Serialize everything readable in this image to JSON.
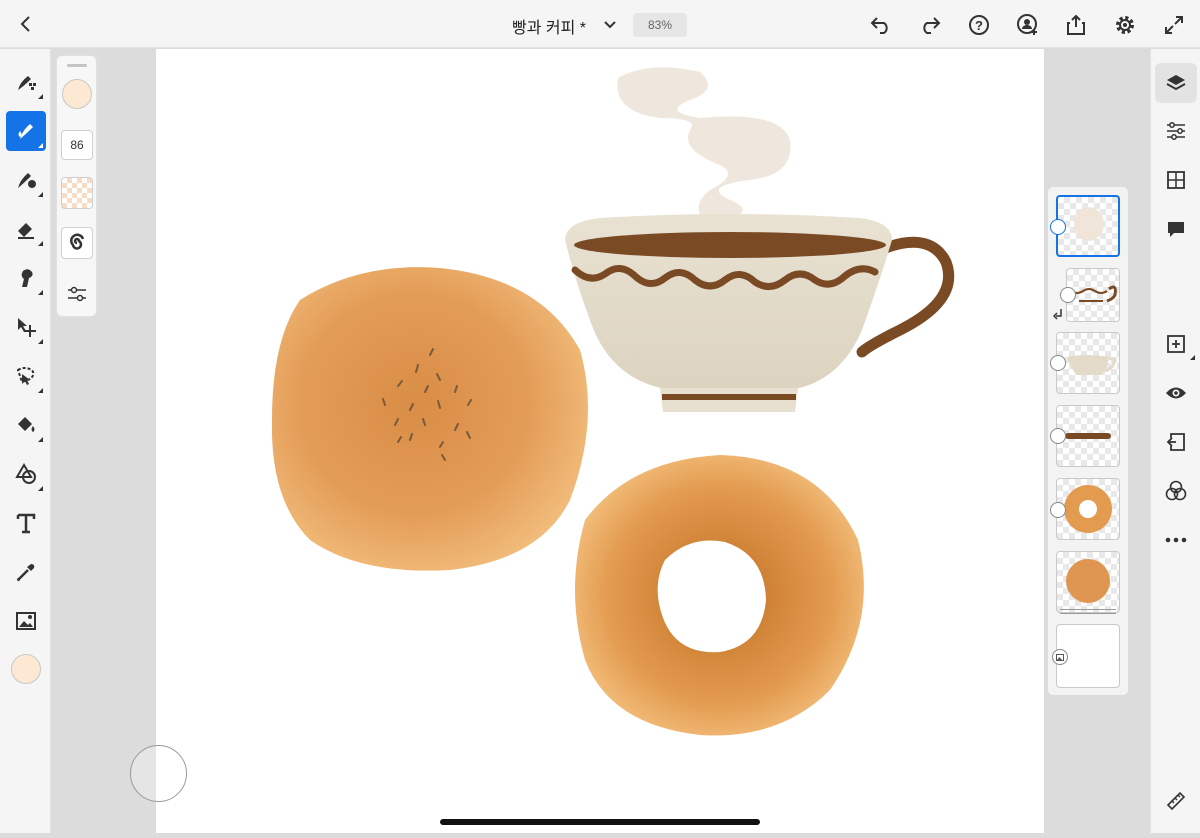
{
  "header": {
    "back_icon": "chevron-left-icon",
    "document_title": "빵과 커피 *",
    "zoom_level": "83%",
    "actions": [
      "undo-icon",
      "redo-icon",
      "help-icon",
      "invite-user-icon",
      "share-icon",
      "settings-icon",
      "fullscreen-icon"
    ]
  },
  "tools": {
    "items": [
      "pixel-brush-icon",
      "live-brush-icon",
      "mixer-brush-icon",
      "eraser-icon",
      "smudge-icon",
      "move-transform-icon",
      "selection-icon",
      "fill-icon",
      "shapes-icon",
      "text-icon",
      "eyedropper-icon",
      "image-icon",
      "color-swatch"
    ],
    "active": "live-brush-icon",
    "current_color": "#fde8d4"
  },
  "brush_props": {
    "color": "#fde8d4",
    "size_value": "86",
    "opacity_icon": "opacity-swatch-icon",
    "flow_icon": "flow-swirl-icon",
    "settings_icon": "brush-settings-icon"
  },
  "right_panel": {
    "items": [
      "layers-icon",
      "layer-properties-icon",
      "grid-icon",
      "comment-icon",
      "add-layer-icon",
      "visibility-icon",
      "import-icon",
      "blend-icon",
      "more-icon",
      "ruler-icon"
    ],
    "active": "layers-icon"
  },
  "layers": {
    "items": [
      "steam",
      "cup-pattern",
      "cup",
      "cup-base",
      "donut",
      "bun",
      "background"
    ],
    "selected": "steam"
  },
  "colors": {
    "accent": "#1473e6",
    "bun": "#e8a15c",
    "coffee": "#7a4a25",
    "cup": "#e4dccb"
  }
}
